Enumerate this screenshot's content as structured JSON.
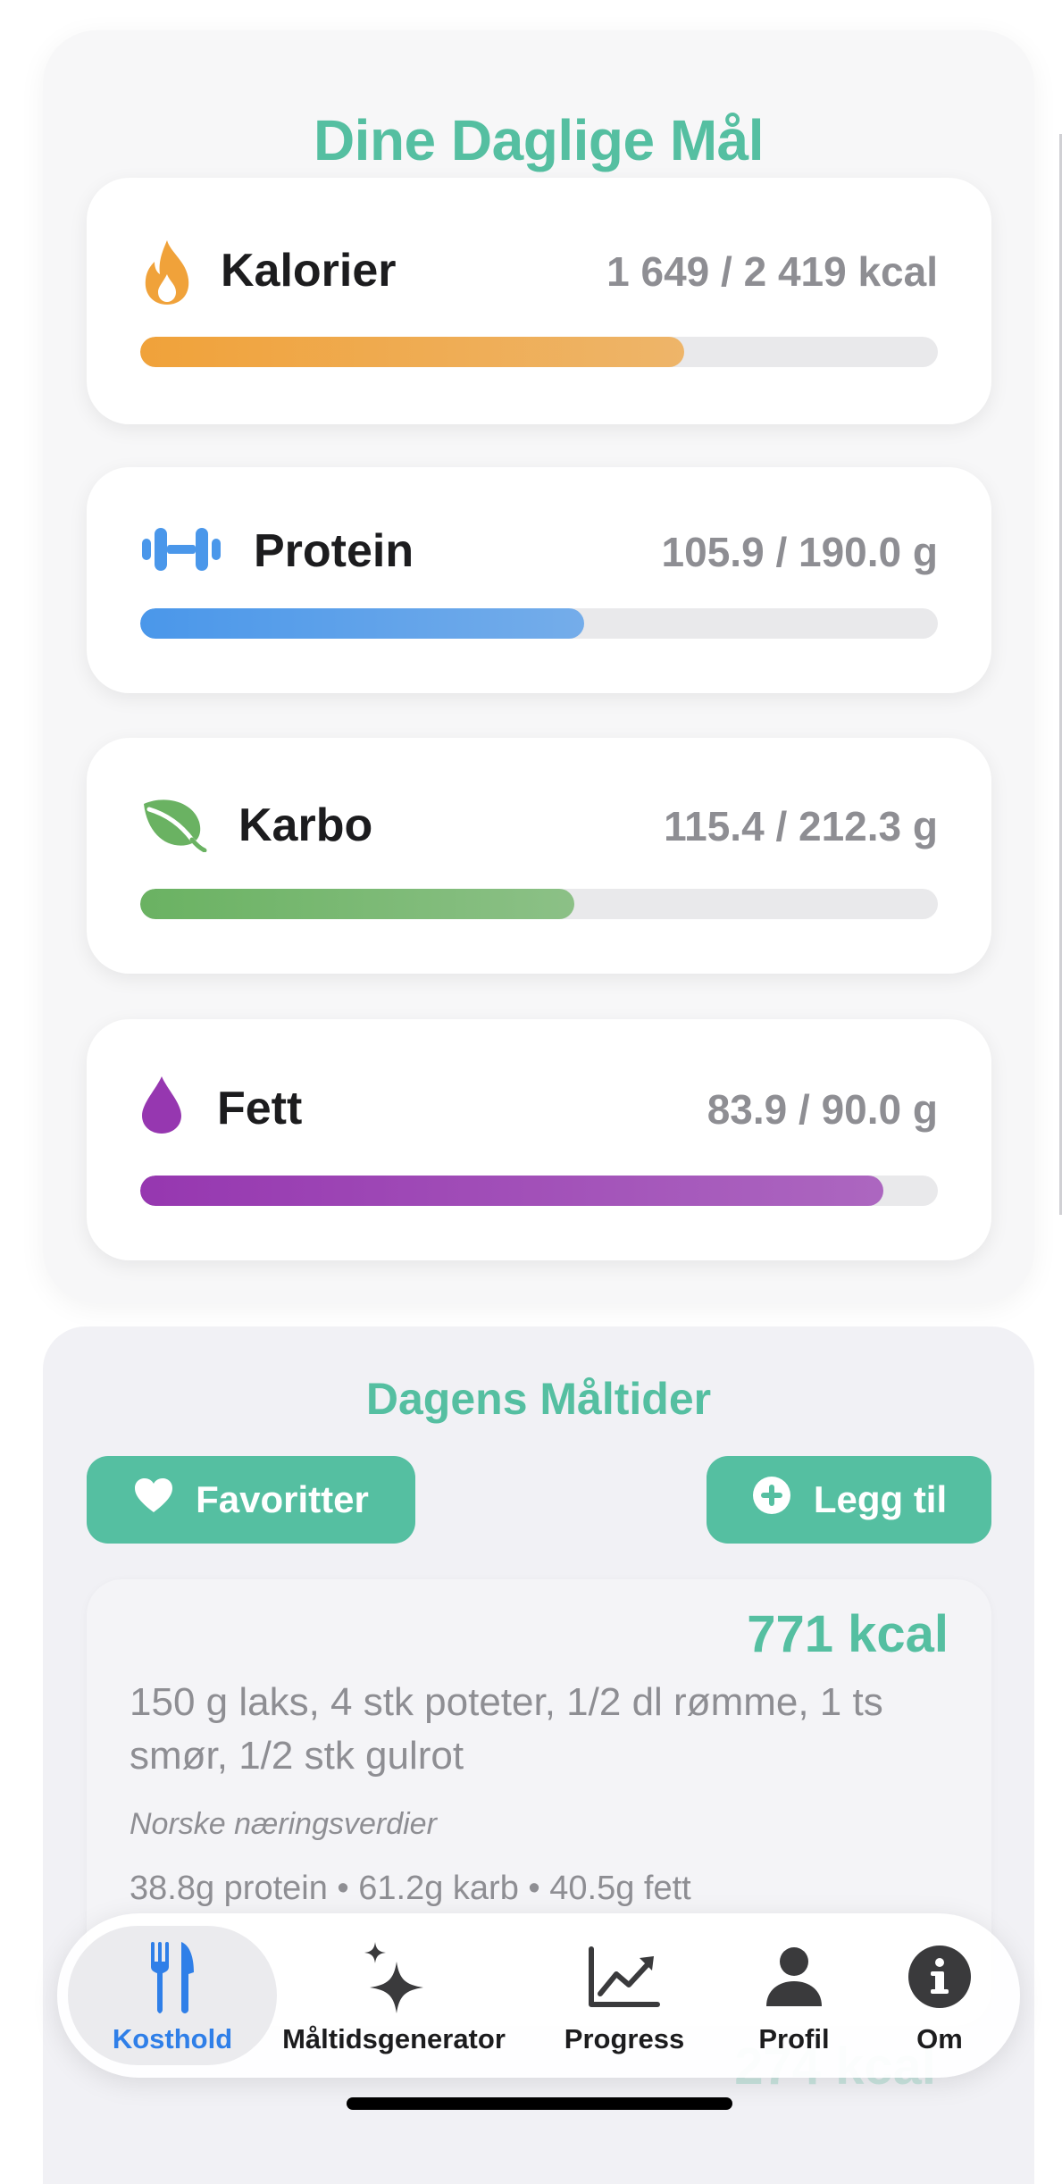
{
  "goals": {
    "title": "Dine Daglige Mål",
    "macros": [
      {
        "name": "Kalorier",
        "value_text": "1 649 / 2 419 kcal",
        "progress": 0.682,
        "color": "#f0a23a",
        "icon": "flame-icon"
      },
      {
        "name": "Protein",
        "value_text": "105.9 / 190.0 g",
        "progress": 0.557,
        "color": "#4a97ea",
        "icon": "dumbbell-icon"
      },
      {
        "name": "Karbo",
        "value_text": "115.4 / 212.3 g",
        "progress": 0.544,
        "color": "#6ab262",
        "icon": "leaf-icon"
      },
      {
        "name": "Fett",
        "value_text": "83.9 / 90.0 g",
        "progress": 0.932,
        "color": "#9637b0",
        "icon": "drop-icon"
      }
    ]
  },
  "meals": {
    "title": "Dagens Måltider",
    "favorites_label": "Favoritter",
    "add_label": "Legg til",
    "items": [
      {
        "kcal": "771 kcal",
        "description": "150 g laks, 4 stk poteter, 1/2 dl rømme, 1 ts smør, 1/2 stk gulrot",
        "source": "Norske næringsverdier",
        "macros": "38.8g protein • 61.2g karb • 40.5g fett"
      }
    ],
    "next_kcal": "274 kcal"
  },
  "tabbar": {
    "tabs": [
      {
        "label": "Kosthold",
        "icon": "fork-knife-icon",
        "active": true
      },
      {
        "label": "Måltidsgenerator",
        "icon": "sparkles-icon",
        "active": false
      },
      {
        "label": "Progress",
        "icon": "chart-icon",
        "active": false
      },
      {
        "label": "Profil",
        "icon": "person-icon",
        "active": false
      },
      {
        "label": "Om",
        "icon": "info-icon",
        "active": false
      }
    ]
  },
  "colors": {
    "accent": "#55bfa1",
    "active_tab": "#2f7fe8"
  }
}
